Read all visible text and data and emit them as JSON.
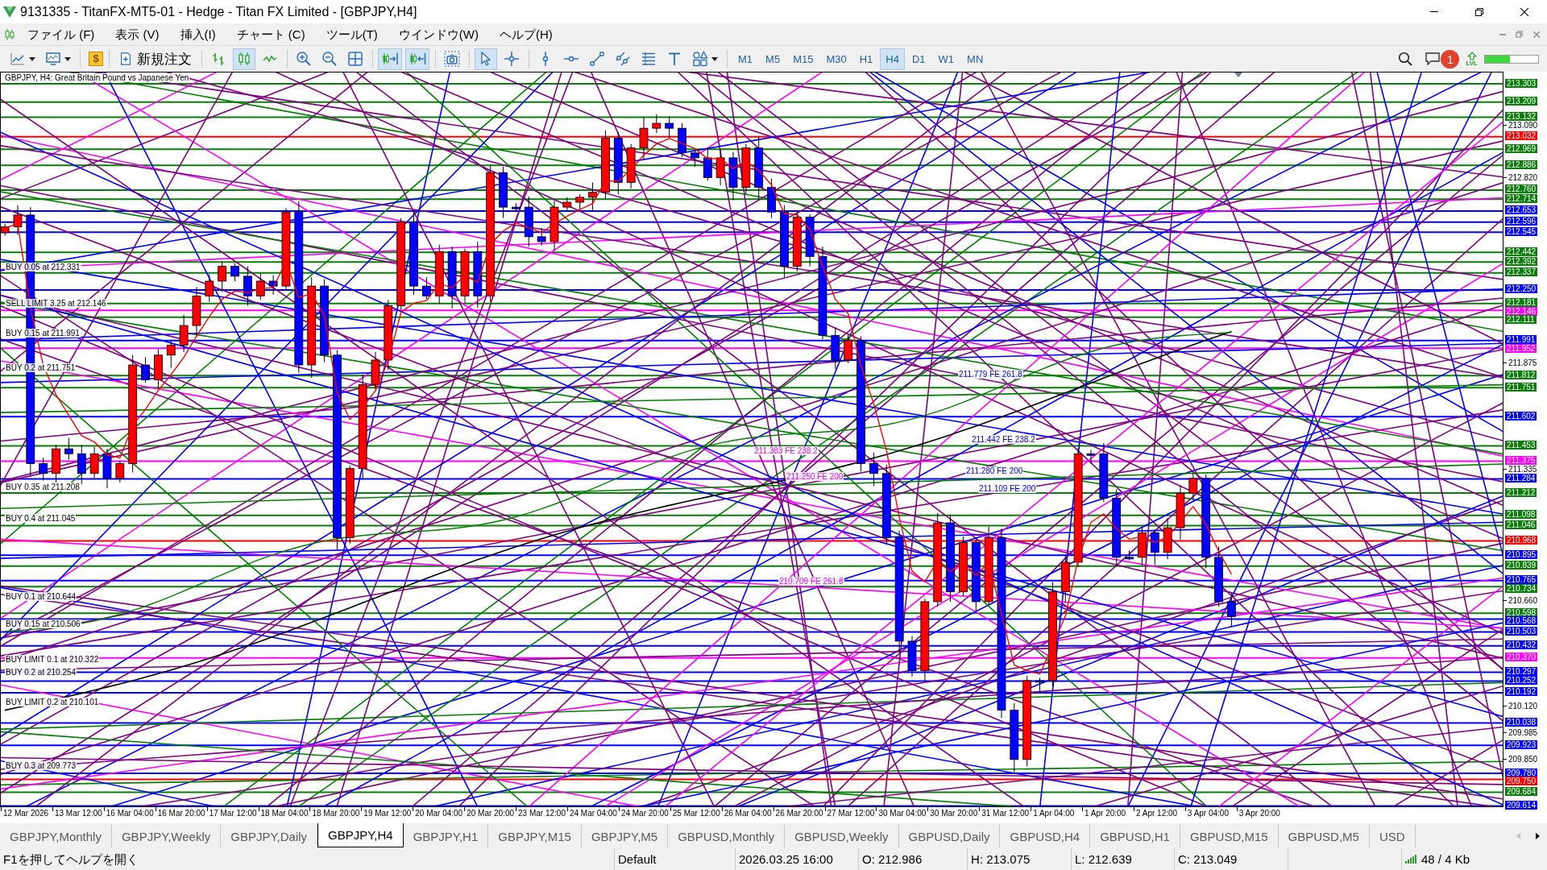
{
  "window": {
    "title": "9131335 - TitanFX-MT5-01 - Hedge - Titan FX Limited - [GBPJPY,H4]"
  },
  "menu": [
    "ファイル (F)",
    "表示 (V)",
    "挿入(I)",
    "チャート (C)",
    "ツール(T)",
    "ウインドウ(W)",
    "ヘルプ(H)"
  ],
  "toolbar": {
    "dollar": "$",
    "new_order": "新規注文",
    "chart_types": {
      "bars": {
        "selected": false
      },
      "candles": {
        "selected": true
      },
      "line": {
        "selected": false
      }
    },
    "autoscroll": {
      "on": true
    },
    "chart_shift": {
      "on": true
    },
    "pointer_tools": {
      "cursor": {
        "selected": true
      },
      "crosshair": {
        "selected": false
      }
    },
    "timeframes": [
      {
        "label": "M1",
        "selected": false
      },
      {
        "label": "M5",
        "selected": false
      },
      {
        "label": "M15",
        "selected": false
      },
      {
        "label": "M30",
        "selected": false
      },
      {
        "label": "H1",
        "selected": false
      },
      {
        "label": "H4",
        "selected": true
      },
      {
        "label": "D1",
        "selected": false
      },
      {
        "label": "W1",
        "selected": false
      },
      {
        "label": "MN",
        "selected": false
      }
    ],
    "notifications": "1",
    "lvl": "LVL",
    "meter": {
      "level": 0.47
    }
  },
  "chart": {
    "caption": "GBPJPY, H4: Great Britain Pound vs Japanese Yen",
    "order_labels": [
      "BUY 0.05 at 212.331",
      "SELL LIMIT 3.25 at 212.146",
      "BUY 0.15 at 211.991",
      "BUY 0.2 at 211.751",
      "BUY 0.35 at 211.208",
      "BUY 0.4 at 211.045",
      "BUY 0.1 at 210.644",
      "BUY 0.15 at 210.506",
      "BUY LIMIT 0.1 at 210.322",
      "BUY 0.2 at 210.254",
      "BUY LIMIT 0.2 at 210.101",
      "BUY 0.3 at 209.773"
    ],
    "fibo_labels": [
      {
        "text": "211.779 FE 261.8",
        "color": "#0000ff"
      },
      {
        "text": "211.442 FE 238.2",
        "color": "#0000ff"
      },
      {
        "text": "211.383 FE 238.2",
        "color": "#ff00ff"
      },
      {
        "text": "211.280 FE 200",
        "color": "#0000ff"
      },
      {
        "text": "211.250 FE 200",
        "color": "#ff00ff"
      },
      {
        "text": "211.109 FE 200",
        "color": "#0000ff"
      },
      {
        "text": "210.709 FE 261.8",
        "color": "#ff00ff"
      }
    ],
    "price_axis": [
      {
        "text": "213.303",
        "kind": "level",
        "color": "#0a7d0a"
      },
      {
        "text": "213.209",
        "kind": "level",
        "color": "#0a7d0a"
      },
      {
        "text": "213.132",
        "kind": "level",
        "color": "#0a7d0a"
      },
      {
        "text": "213.090",
        "kind": "tick"
      },
      {
        "text": "213.032",
        "kind": "level",
        "color": "#ff0000"
      },
      {
        "text": "212.969",
        "kind": "level",
        "color": "#0a7d0a"
      },
      {
        "text": "212.886",
        "kind": "level",
        "color": "#0a7d0a"
      },
      {
        "text": "212.820",
        "kind": "tick"
      },
      {
        "text": "212.760",
        "kind": "level",
        "color": "#0a7d0a"
      },
      {
        "text": "212.714",
        "kind": "level",
        "color": "#0a7d0a"
      },
      {
        "text": "212.653",
        "kind": "level",
        "color": "#0000ff"
      },
      {
        "text": "212.596",
        "kind": "level",
        "color": "#0000ff"
      },
      {
        "text": "212.545",
        "kind": "level",
        "color": "#0000ff"
      },
      {
        "text": "212.442",
        "kind": "level",
        "color": "#0a7d0a"
      },
      {
        "text": "212.392",
        "kind": "level",
        "color": "#0a7d0a"
      },
      {
        "text": "212.337",
        "kind": "level",
        "color": "#0a7d0a"
      },
      {
        "text": "212.250",
        "kind": "level",
        "color": "#0000ff"
      },
      {
        "text": "212.181",
        "kind": "level",
        "color": "#0a7d0a"
      },
      {
        "text": "212.146",
        "kind": "level",
        "color": "#ff00ff"
      },
      {
        "text": "212.111",
        "kind": "level",
        "color": "#0a7d0a"
      },
      {
        "text": "211.991",
        "kind": "level",
        "color": "#0000ff"
      },
      {
        "text": "211.952",
        "kind": "level",
        "color": "#ff00ff"
      },
      {
        "text": "211.875",
        "kind": "tick"
      },
      {
        "text": "211.812",
        "kind": "level",
        "color": "#0a7d0a"
      },
      {
        "text": "211.751",
        "kind": "level",
        "color": "#0a7d0a"
      },
      {
        "text": "211.602",
        "kind": "level",
        "color": "#0000ff"
      },
      {
        "text": "211.453",
        "kind": "level",
        "color": "#0a7d0a"
      },
      {
        "text": "211.375",
        "kind": "level",
        "color": "#ff00ff"
      },
      {
        "text": "211.335",
        "kind": "tick"
      },
      {
        "text": "211.284",
        "kind": "level",
        "color": "#0000ff"
      },
      {
        "text": "211.212",
        "kind": "level",
        "color": "#0a7d0a"
      },
      {
        "text": "211.098",
        "kind": "level",
        "color": "#0a7d0a"
      },
      {
        "text": "211.046",
        "kind": "level",
        "color": "#0a7d0a"
      },
      {
        "text": "210.968",
        "kind": "level",
        "color": "#ff0000"
      },
      {
        "text": "210.895",
        "kind": "level",
        "color": "#0000ff"
      },
      {
        "text": "210.839",
        "kind": "level",
        "color": "#0a7d0a"
      },
      {
        "text": "210.765",
        "kind": "level",
        "color": "#0000ff"
      },
      {
        "text": "210.734",
        "kind": "level",
        "color": "#0a7d0a"
      },
      {
        "text": "210.660",
        "kind": "tick"
      },
      {
        "text": "210.598",
        "kind": "level",
        "color": "#0a7d0a"
      },
      {
        "text": "210.568",
        "kind": "level",
        "color": "#0000ff"
      },
      {
        "text": "210.503",
        "kind": "level",
        "color": "#0000ff"
      },
      {
        "text": "210.432",
        "kind": "level",
        "color": "#0000ff"
      },
      {
        "text": "210.370",
        "kind": "level",
        "color": "#ff00ff"
      },
      {
        "text": "210.297",
        "kind": "level",
        "color": "#0000ff"
      },
      {
        "text": "210.252",
        "kind": "level",
        "color": "#0000ff"
      },
      {
        "text": "210.192",
        "kind": "level",
        "color": "#0000ff"
      },
      {
        "text": "210.120",
        "kind": "tick"
      },
      {
        "text": "210.038",
        "kind": "level",
        "color": "#0000ff"
      },
      {
        "text": "209.985",
        "kind": "tick"
      },
      {
        "text": "209.923",
        "kind": "level",
        "color": "#0000ff"
      },
      {
        "text": "209.850",
        "kind": "tick"
      },
      {
        "text": "209.780",
        "kind": "level",
        "color": "#0000ff"
      },
      {
        "text": "209.750",
        "kind": "level",
        "color": "#ff0000"
      },
      {
        "text": "209.684",
        "kind": "level",
        "color": "#0a7d0a"
      },
      {
        "text": "209.614",
        "kind": "level",
        "color": "#0000ff"
      }
    ],
    "time_axis": [
      "12 Mar 2026",
      "13 Mar 12:00",
      "16 Mar 04:00",
      "16 Mar 20:00",
      "17 Mar 12:00",
      "18 Mar 04:00",
      "18 Mar 20:00",
      "19 Mar 12:00",
      "20 Mar 04:00",
      "20 Mar 20:00",
      "23 Mar 12:00",
      "24 Mar 04:00",
      "24 Mar 20:00",
      "25 Mar 12:00",
      "26 Mar 04:00",
      "26 Mar 20:00",
      "27 Mar 12:00",
      "30 Mar 04:00",
      "30 Mar 20:00",
      "31 Mar 12:00",
      "1 Apr 04:00",
      "1 Apr 20:00",
      "2 Apr 12:00",
      "3 Apr 04:00",
      "3 Apr 20:00"
    ]
  },
  "tabs": [
    {
      "label": "GBPJPY,Monthly",
      "selected": false
    },
    {
      "label": "GBPJPY,Weekly",
      "selected": false
    },
    {
      "label": "GBPJPY,Daily",
      "selected": false
    },
    {
      "label": "GBPJPY,H4",
      "selected": true
    },
    {
      "label": "GBPJPY,H1",
      "selected": false
    },
    {
      "label": "GBPJPY,M15",
      "selected": false
    },
    {
      "label": "GBPJPY,M5",
      "selected": false
    },
    {
      "label": "GBPUSD,Monthly",
      "selected": false
    },
    {
      "label": "GBPUSD,Weekly",
      "selected": false
    },
    {
      "label": "GBPUSD,Daily",
      "selected": false
    },
    {
      "label": "GBPUSD,H4",
      "selected": false
    },
    {
      "label": "GBPUSD,H1",
      "selected": false
    },
    {
      "label": "GBPUSD,M15",
      "selected": false
    },
    {
      "label": "GBPUSD,M5",
      "selected": false
    },
    {
      "label": "USD",
      "selected": false
    }
  ],
  "status_bar": {
    "help": "F1を押してヘルプを開く",
    "profile": "Default",
    "time": "2026.03.25 16:00",
    "open": "O: 212.986",
    "high": "H: 213.075",
    "low": "L: 212.639",
    "close": "C: 213.049",
    "traffic": "48 / 4 Kb"
  }
}
